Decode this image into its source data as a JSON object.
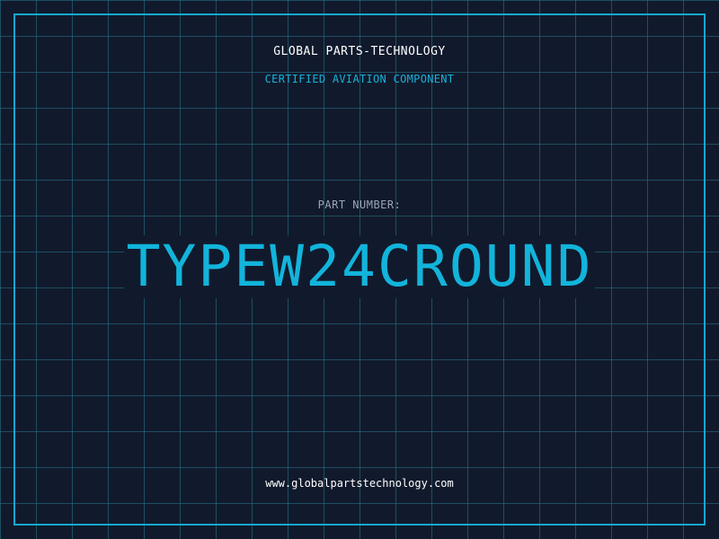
{
  "company": "GLOBAL PARTS-TECHNOLOGY",
  "certification": "CERTIFIED AVIATION COMPONENT",
  "part_label": "PART NUMBER:",
  "part_number": "TYPEW24CROUND",
  "website": "www.globalpartstechnology.com",
  "colors": {
    "background": "#111a2c",
    "grid": "#28788c",
    "accent": "#17a8cf",
    "text_primary": "#ffffff",
    "text_muted": "#9aa6b8"
  }
}
